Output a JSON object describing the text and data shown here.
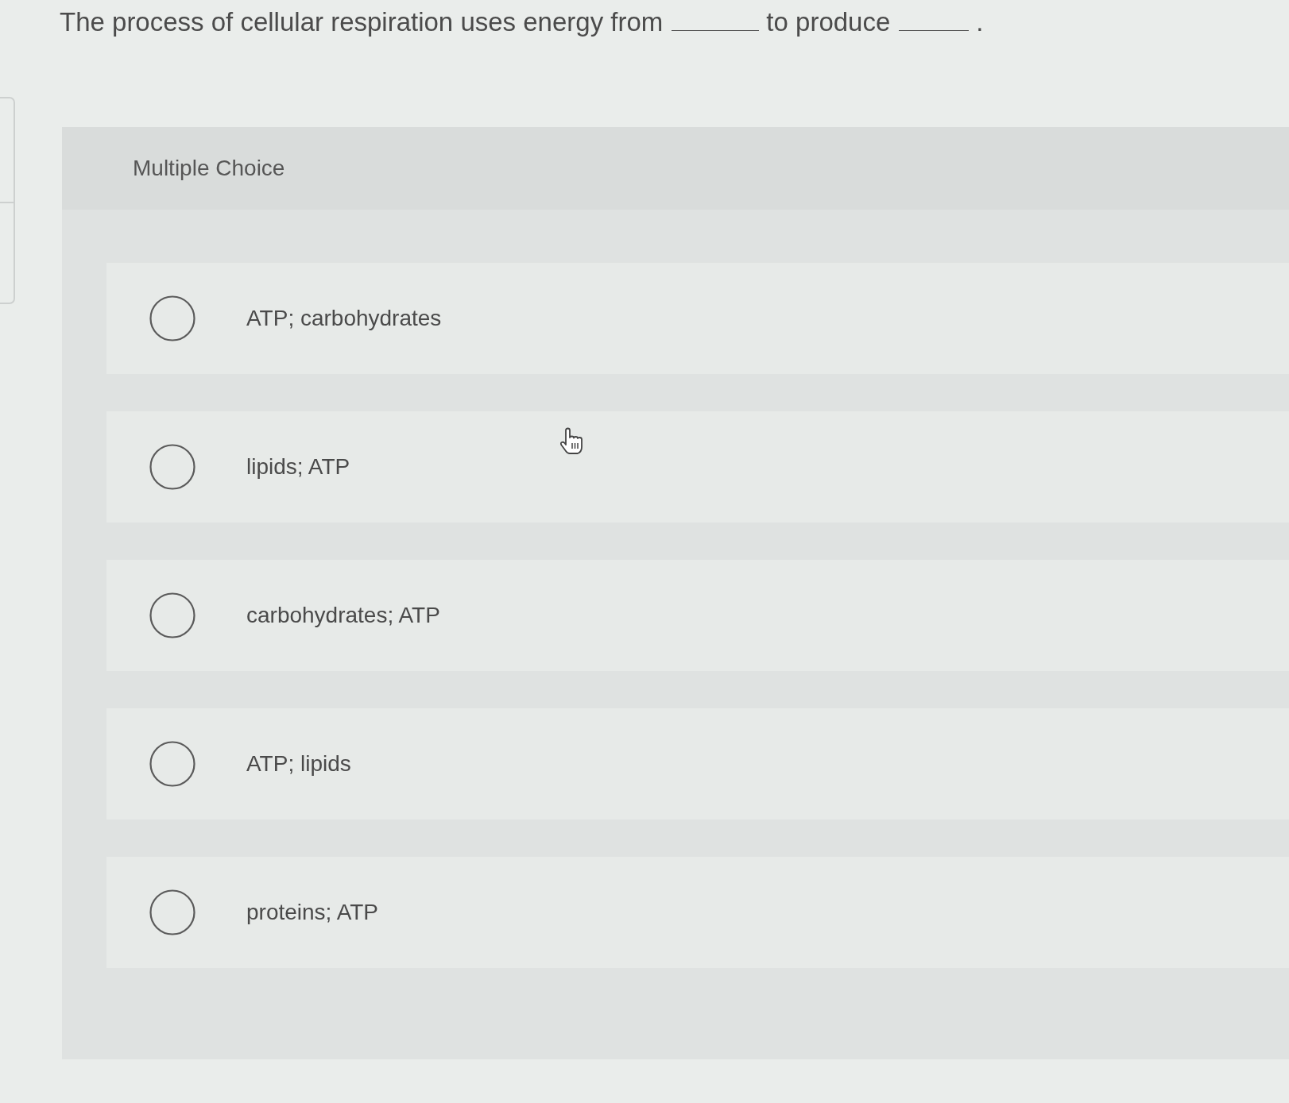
{
  "question": {
    "parts": [
      {
        "kind": "text",
        "text": "The process of cellular respiration uses energy from"
      },
      {
        "kind": "blank"
      },
      {
        "kind": "text",
        "text": "to produce"
      },
      {
        "kind": "blank"
      },
      {
        "kind": "text",
        "text": "."
      }
    ]
  },
  "panel": {
    "title": "Multiple Choice"
  },
  "options": [
    {
      "label": "ATP; carbohydrates",
      "selected": false
    },
    {
      "label": "lipids; ATP",
      "selected": false
    },
    {
      "label": "carbohydrates; ATP",
      "selected": false
    },
    {
      "label": "ATP; lipids",
      "selected": false
    },
    {
      "label": "proteins; ATP",
      "selected": false
    }
  ]
}
